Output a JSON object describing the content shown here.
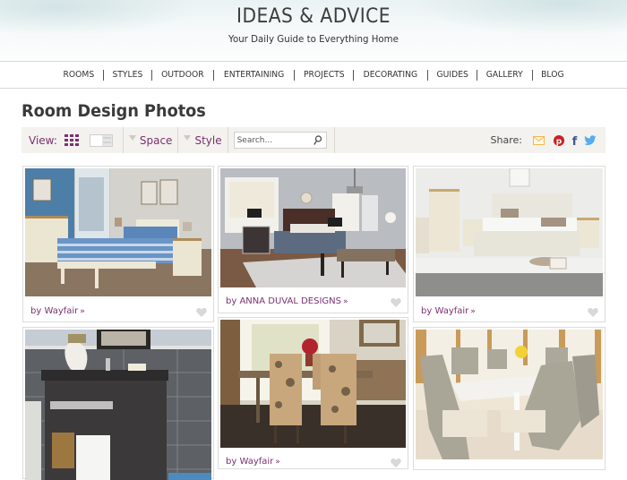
{
  "header": {
    "title": "IDEAS & ADVICE",
    "tagline": "Your Daily Guide to Everything Home"
  },
  "nav": {
    "items": [
      "ROOMS",
      "STYLES",
      "OUTDOOR",
      "ENTERTAINING",
      "PROJECTS",
      "DECORATING",
      "GUIDES",
      "GALLERY",
      "BLOG"
    ]
  },
  "page": {
    "title": "Room Design Photos"
  },
  "toolbar": {
    "view_label": "View:",
    "view_modes": [
      "grid-view-icon",
      "list-view-icon"
    ],
    "active_view": "grid",
    "filters": [
      {
        "label": "Space"
      },
      {
        "label": "Style"
      }
    ],
    "search": {
      "placeholder": "Search...",
      "value": ""
    },
    "share_label": "Share:",
    "share_icons": [
      "email-icon",
      "pinterest-icon",
      "facebook-icon",
      "twitter-icon"
    ]
  },
  "colors": {
    "accent": "#7a3070",
    "email": "#f2b84b",
    "pinterest": "#cb2027",
    "facebook": "#3b5998",
    "twitter": "#55acee",
    "toolbar_bg": "#f4f2ee"
  },
  "photos": [
    {
      "scene": "bedroom with blue striped bed",
      "credit": "by Wayfair",
      "arrow": "»"
    },
    {
      "scene": "grey bedroom with dark bed and bench",
      "credit": "by ANNA DUVAL DESIGNS",
      "arrow": "»"
    },
    {
      "scene": "white bedroom with cream slatted bed",
      "credit": "by Wayfair",
      "arrow": "»"
    },
    {
      "scene": "bathroom vanity with dark tiles",
      "credit": "",
      "arrow": ""
    },
    {
      "scene": "dining room with floral chairs",
      "credit": "by Wayfair",
      "arrow": "»"
    },
    {
      "scene": "conservatory dining with wicker chairs",
      "credit": "",
      "arrow": ""
    }
  ]
}
